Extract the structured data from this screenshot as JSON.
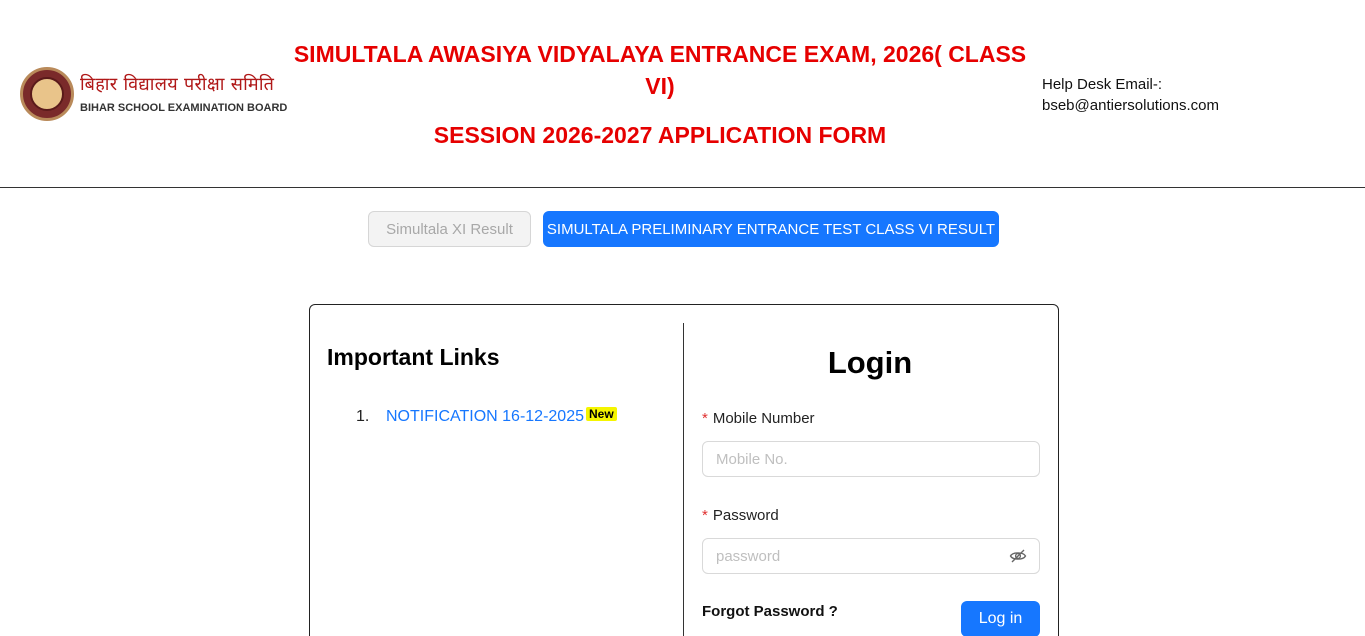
{
  "header": {
    "logo_hindi": "बिहार विद्यालय परीक्षा समिति",
    "logo_english": "BIHAR SCHOOL EXAMINATION BOARD",
    "title_main": "SIMULTALA AWASIYA VIDYALAYA ENTRANCE EXAM, 2026( CLASS VI)",
    "title_session": "SESSION 2026-2027 APPLICATION FORM",
    "help_label": "Help Desk Email-:",
    "help_email": "bseb@antiersolutions.com"
  },
  "results": {
    "xi_result_label": "Simultala XI Result",
    "vi_result_label": "SIMULTALA PRELIMINARY ENTRANCE TEST CLASS VI RESULT"
  },
  "important_links": {
    "title": "Important Links",
    "items": [
      {
        "number": "1.",
        "label": "NOTIFICATION 16-12-2025",
        "badge": "New"
      }
    ]
  },
  "login": {
    "title": "Login",
    "mobile_label": "Mobile Number",
    "mobile_placeholder": "Mobile No.",
    "password_label": "Password",
    "password_placeholder": "password",
    "required_mark": "*",
    "forgot_label": "Forgot Password ?",
    "submit_label": "Log in"
  },
  "colors": {
    "title_red": "#e60000",
    "primary_blue": "#1677ff",
    "badge_yellow": "#f5f500"
  },
  "icons": {
    "password_toggle": "eye-invisible-icon",
    "logo": "bseb-seal-icon"
  }
}
